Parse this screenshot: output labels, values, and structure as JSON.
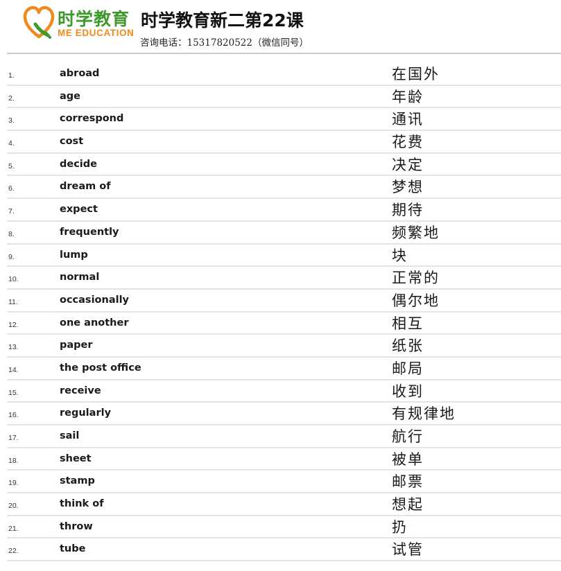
{
  "header": {
    "logo": {
      "cn_text": "时学教育",
      "en_text": "ME EDUCATION",
      "icon": "heart-logo-icon",
      "colors": {
        "green": "#3d9a2b",
        "orange": "#f08a1c"
      }
    },
    "title": "时学教育新二第22课",
    "phone": "咨询电话：15317820522（微信同号）"
  },
  "vocab": [
    {
      "num": "1.",
      "en": "abroad",
      "cn": "在国外"
    },
    {
      "num": "2.",
      "en": "age",
      "cn": "年龄"
    },
    {
      "num": "3.",
      "en": "correspond",
      "cn": "通讯"
    },
    {
      "num": "4.",
      "en": "cost",
      "cn": "花费"
    },
    {
      "num": "5.",
      "en": "decide",
      "cn": "决定"
    },
    {
      "num": "6.",
      "en": "dream of",
      "cn": "梦想"
    },
    {
      "num": "7.",
      "en": "expect",
      "cn": "期待"
    },
    {
      "num": "8.",
      "en": "frequently",
      "cn": "频繁地"
    },
    {
      "num": "9.",
      "en": "lump",
      "cn": "块"
    },
    {
      "num": "10.",
      "en": "normal",
      "cn": "正常的"
    },
    {
      "num": "11.",
      "en": "occasionally",
      "cn": "偶尔地"
    },
    {
      "num": "12.",
      "en": "one another",
      "cn": "相互"
    },
    {
      "num": "13.",
      "en": "paper",
      "cn": "纸张"
    },
    {
      "num": "14.",
      "en": "the post office",
      "cn": "邮局"
    },
    {
      "num": "15.",
      "en": "receive",
      "cn": "收到"
    },
    {
      "num": "16.",
      "en": "regularly",
      "cn": "有规律地"
    },
    {
      "num": "17.",
      "en": "sail",
      "cn": "航行"
    },
    {
      "num": "18.",
      "en": "sheet",
      "cn": "被单"
    },
    {
      "num": "19.",
      "en": "stamp",
      "cn": "邮票"
    },
    {
      "num": "20.",
      "en": "think of",
      "cn": "想起"
    },
    {
      "num": "21.",
      "en": "throw",
      "cn": "扔"
    },
    {
      "num": "22.",
      "en": "tube",
      "cn": "试管"
    }
  ]
}
